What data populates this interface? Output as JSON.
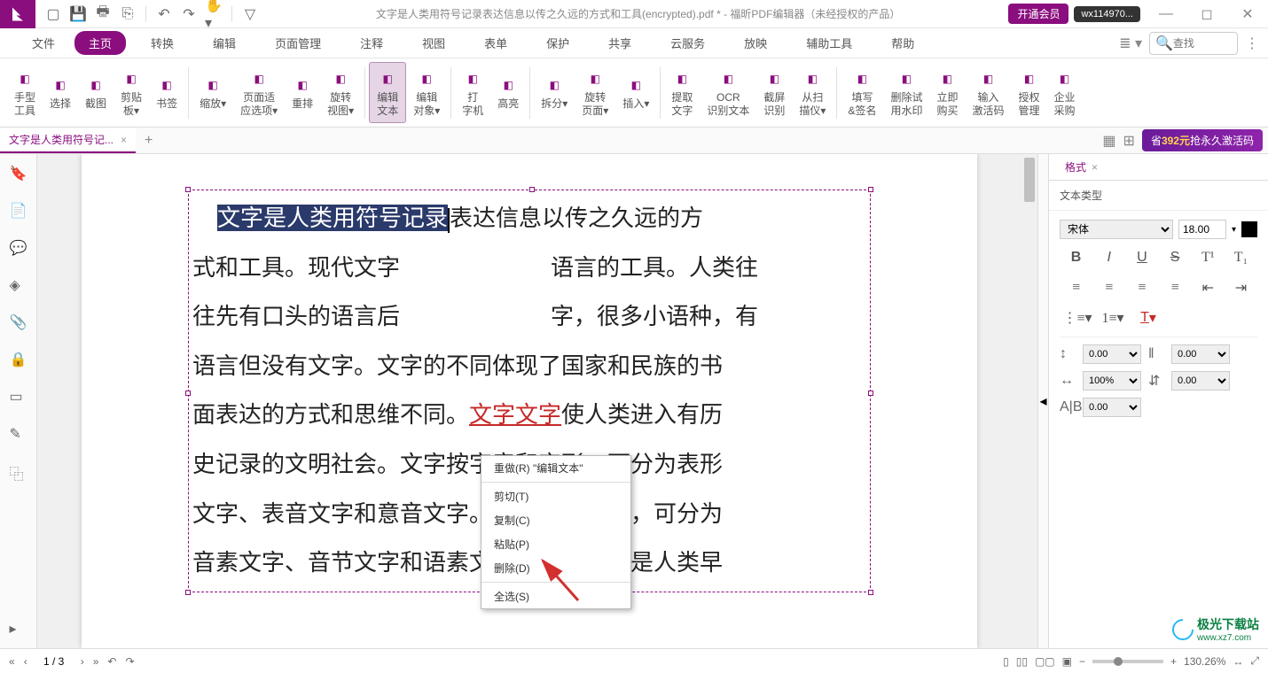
{
  "title": "文字是人类用符号记录表达信息以传之久远的方式和工具(encrypted).pdf * - 福昕PDF编辑器（未经授权的产品）",
  "vip": "开通会员",
  "user": "wx114970...",
  "menu": {
    "file": "文件",
    "items": [
      "主页",
      "转换",
      "编辑",
      "页面管理",
      "注释",
      "视图",
      "表单",
      "保护",
      "共享",
      "云服务",
      "放映",
      "辅助工具",
      "帮助"
    ],
    "activeIndex": 0,
    "search_placeholder": "查找"
  },
  "ribbon": [
    {
      "lbl": "手型\n工具"
    },
    {
      "lbl": "选择"
    },
    {
      "lbl": "截图"
    },
    {
      "lbl": "剪贴\n板▾"
    },
    {
      "lbl": "书签"
    },
    {
      "sep": true
    },
    {
      "lbl": "缩放▾"
    },
    {
      "lbl": "页面适\n应选项▾"
    },
    {
      "lbl": "重排"
    },
    {
      "lbl": "旋转\n视图▾"
    },
    {
      "sep": true
    },
    {
      "lbl": "编辑\n文本",
      "active": true
    },
    {
      "lbl": "编辑\n对象▾"
    },
    {
      "sep": true
    },
    {
      "lbl": "打\n字机"
    },
    {
      "lbl": "高亮"
    },
    {
      "sep": true
    },
    {
      "lbl": "拆分▾"
    },
    {
      "lbl": "旋转\n页面▾"
    },
    {
      "lbl": "插入▾"
    },
    {
      "sep": true
    },
    {
      "lbl": "提取\n文字"
    },
    {
      "lbl": "OCR\n识别文本"
    },
    {
      "lbl": "截屏\n识别"
    },
    {
      "lbl": "从扫\n描仪▾"
    },
    {
      "sep": true
    },
    {
      "lbl": "填写\n&签名"
    },
    {
      "lbl": "删除试\n用水印"
    },
    {
      "lbl": "立即\n购买"
    },
    {
      "lbl": "输入\n激活码"
    },
    {
      "lbl": "授权\n管理"
    },
    {
      "lbl": "企业\n采购"
    }
  ],
  "doctab": {
    "name": "文字是人类用符号记...",
    "add": "+"
  },
  "promo": {
    "pre": "省",
    "amt": "392元",
    "post": "抢永久激活码"
  },
  "doc": {
    "selected": "文字是人类用符号记录",
    "line1_rest": "表达信息以传之久远的方",
    "line2": "式和工具。现代文字",
    "line2b": "语言的工具。人类往",
    "line3a": "往先有口头的语言后",
    "line3b": "字，很多小语种，有",
    "line4a": "语言但没有文字。文字的不同体现了国家和民族的书",
    "line5a": "面表达的方式和思维不同。",
    "redund": "文字文字",
    "line5b": "使人类进入有历",
    "line6": "史记录的文明社会。文字按字音和字形，可分为表形",
    "line7": "文字、表音文字和意音文字。按语音和语素，可分为",
    "line8": "音素文字、音节文字和语素文字。表形文字是人类早"
  },
  "ctx": [
    "重做(R) \"编辑文本\"",
    "剪切(T)",
    "复制(C)",
    "粘贴(P)",
    "删除(D)",
    "全选(S)"
  ],
  "rp": {
    "tab": "格式",
    "section": "文本类型",
    "font": "宋体",
    "size": "18.00",
    "spacing": {
      "a": "0.00",
      "b": "0.00",
      "c": "100%",
      "d": "0.00",
      "e": "0.00"
    }
  },
  "status": {
    "page": "1 / 3",
    "zoom": "130.26%"
  },
  "watermark": "极光下载站",
  "watermark_url": "www.xz7.com"
}
